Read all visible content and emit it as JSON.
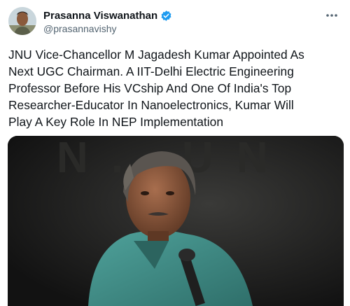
{
  "tweet": {
    "author": {
      "display_name": "Prasanna Viswanathan",
      "handle": "@prasannavishy",
      "verified": true,
      "avatar_icon": "avatar-photo"
    },
    "text": "JNU Vice-Chancellor M Jagadesh Kumar Appointed As\nNext UGC Chairman. A  IIT-Delhi Electric Engineering\nProfessor Before His VCship And One Of India's Top\nResearcher-Educator In Nanoelectronics, Kumar Will\nPlay A Key Role In NEP Implementation",
    "more_icon": "more-icon",
    "media": {
      "type": "photo",
      "backdrop_lettering": "N . . U N"
    }
  },
  "colors": {
    "verified_badge": "#1d9bf0",
    "secondary_text": "#536471",
    "primary_text": "#0f1419",
    "shirt": "#3f8f89"
  }
}
